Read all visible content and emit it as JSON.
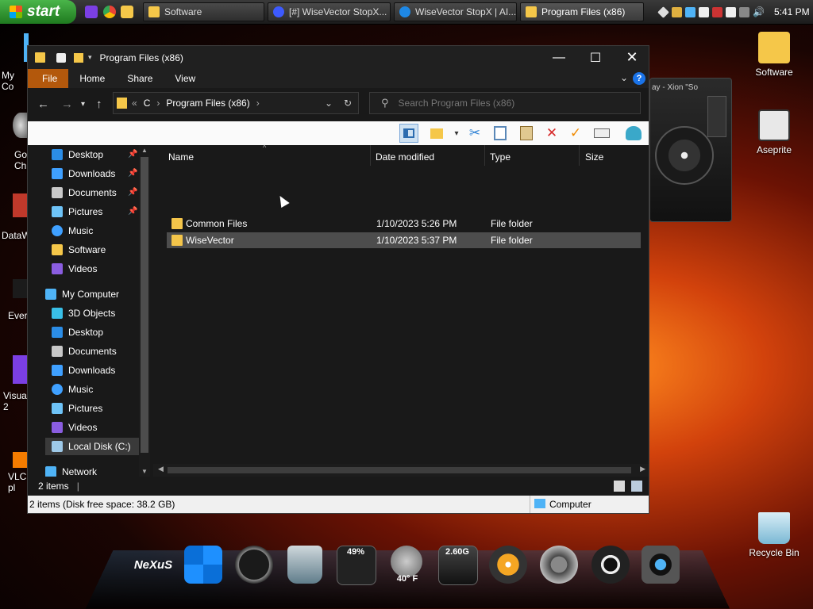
{
  "taskbar": {
    "start_label": "start",
    "tasks": [
      {
        "label": "Software",
        "color": "#f5c749"
      },
      {
        "label": "[#] WiseVector StopX...",
        "color": "#3d5afe"
      },
      {
        "label": "WiseVector StopX | AI...",
        "color": "#1e88e5"
      },
      {
        "label": "Program Files (x86)",
        "color": "#f5c749"
      }
    ],
    "clock": "5:41 PM"
  },
  "desktop": {
    "left_icons": [
      "My Co",
      "Go\nChr",
      "DataW",
      "Ever",
      "Visua\n2",
      "VLC\npl"
    ],
    "right_icons": [
      {
        "label": "Software",
        "color": "#f5c749"
      },
      {
        "label": "Aseprite",
        "color": "#e8e8e8"
      },
      {
        "label": "Recycle Bin",
        "color": "#9ad0e8"
      }
    ],
    "widget_title": "ay - Xion \"So"
  },
  "window": {
    "title": "Program Files (x86)",
    "ribbon_tabs": [
      "File",
      "Home",
      "Share",
      "View"
    ],
    "address": {
      "root": "C",
      "current": "Program Files (x86)"
    },
    "search_placeholder": "Search Program Files (x86)",
    "nav_items": [
      {
        "label": "Desktop",
        "color": "#2b8de6",
        "pinned": "📌"
      },
      {
        "label": "Downloads",
        "color": "#3fa0ff",
        "pinned": "📌"
      },
      {
        "label": "Documents",
        "color": "#c8c8c8",
        "pinned": "📌"
      },
      {
        "label": "Pictures",
        "color": "#6ec3f7",
        "pinned": "📌"
      },
      {
        "label": "Music",
        "color": "#3fa0ff"
      },
      {
        "label": "Software",
        "color": "#f5c749"
      },
      {
        "label": "Videos",
        "color": "#8a5de0"
      },
      {
        "label": "My Computer",
        "color": "#4fb3f6"
      },
      {
        "label": "3D Objects",
        "color": "#39c0e8"
      },
      {
        "label": "Desktop",
        "color": "#2b8de6"
      },
      {
        "label": "Documents",
        "color": "#c8c8c8"
      },
      {
        "label": "Downloads",
        "color": "#3fa0ff"
      },
      {
        "label": "Music",
        "color": "#3fa0ff"
      },
      {
        "label": "Pictures",
        "color": "#6ec3f7"
      },
      {
        "label": "Videos",
        "color": "#8a5de0"
      },
      {
        "label": "Local Disk (C:)",
        "color": "#9ec9e8"
      },
      {
        "label": "Network",
        "color": "#4fb3f6"
      }
    ],
    "columns": [
      "Name",
      "Date modified",
      "Type",
      "Size"
    ],
    "rows": [
      {
        "name": "Common Files",
        "date": "1/10/2023 5:26 PM",
        "type": "File folder",
        "size": ""
      },
      {
        "name": "WiseVector",
        "date": "1/10/2023 5:37 PM",
        "type": "File folder",
        "size": ""
      }
    ],
    "status_items": "2 items",
    "bottom_status": "2 items (Disk free space: 38.2 GB)",
    "bottom_location": "Computer"
  },
  "dock": {
    "items": [
      "nexus",
      "windows",
      "clock",
      "recycle",
      "cpu",
      "weather",
      "disk",
      "browser",
      "power",
      "media",
      "camera"
    ],
    "logo_label": "NeXuS",
    "cpu_label": "49%",
    "weather_label": "40° F",
    "disk_label": "2.60G"
  }
}
